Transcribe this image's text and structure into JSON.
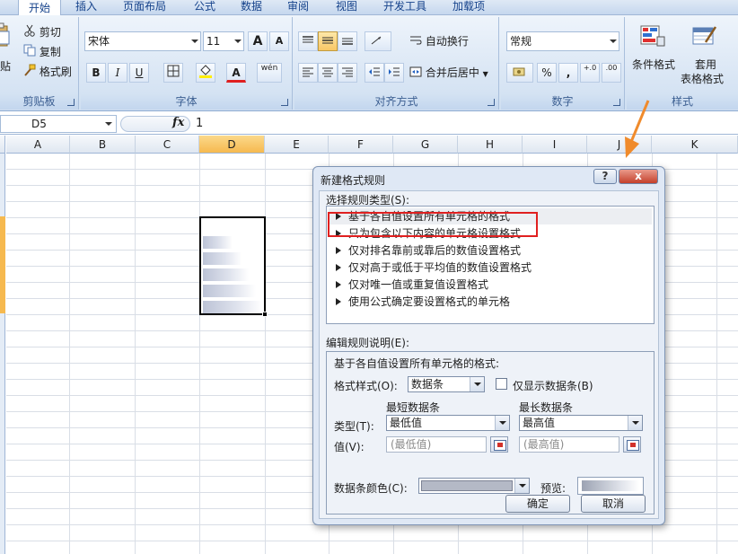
{
  "ribbon": {
    "tabs": [
      "开始",
      "插入",
      "页面布局",
      "公式",
      "数据",
      "审阅",
      "视图",
      "开发工具",
      "加载项"
    ],
    "clipboard": {
      "paste": "贴",
      "cut": "剪切",
      "copy": "复制",
      "format_painter": "格式刷",
      "label": "剪贴板"
    },
    "font": {
      "name": "宋体",
      "size": "11",
      "grow": "A",
      "shrink": "A",
      "bold": "B",
      "italic": "I",
      "underline": "U",
      "color_a": "A",
      "phonetic": "wén",
      "label": "字体"
    },
    "alignment": {
      "wrap": "自动换行",
      "merge": "合并后居中",
      "label": "对齐方式"
    },
    "number": {
      "format": "常规",
      "percent": "%",
      "comma": ",",
      "inc_dec": "+.0",
      "dec_dec": ".00",
      "label": "数字"
    },
    "styles": {
      "conditional_format": "条件格式",
      "table_format_1": "套用",
      "table_format_2": "表格格式",
      "label": "样式"
    }
  },
  "formula_bar": {
    "name_box": "D5",
    "fx": "fx",
    "value": "1"
  },
  "grid": {
    "columns": [
      "A",
      "B",
      "C",
      "D",
      "E",
      "F",
      "G",
      "H",
      "I",
      "J",
      "K"
    ],
    "selected_column": "D",
    "databar_fractions": [
      0.5,
      0.65,
      0.78,
      0.9,
      1.0
    ]
  },
  "dialog": {
    "title": "新建格式规则",
    "help_btn": "?",
    "close_btn": "x",
    "rule_type_label": "选择规则类型(S):",
    "rule_types": [
      "基于各自值设置所有单元格的格式",
      "只为包含以下内容的单元格设置格式",
      "仅对排名靠前或靠后的数值设置格式",
      "仅对高于或低于平均值的数值设置格式",
      "仅对唯一值或重复值设置格式",
      "使用公式确定要设置格式的单元格"
    ],
    "edit_label": "编辑规则说明(E):",
    "edit_heading": "基于各自值设置所有单元格的格式:",
    "format_style_label": "格式样式(O):",
    "format_style_value": "数据条",
    "show_bar_only_label": "仅显示数据条(B)",
    "shortest_bar_label": "最短数据条",
    "longest_bar_label": "最长数据条",
    "type_label": "类型(T):",
    "type_min_value": "最低值",
    "type_max_value": "最高值",
    "value_label": "值(V):",
    "value_min_placeholder": "(最低值)",
    "value_max_placeholder": "(最高值)",
    "bar_color_label": "数据条颜色(C):",
    "preview_label": "预览:",
    "ok_btn": "确定",
    "cancel_btn": "取消"
  },
  "colors": {
    "annotation": "#f08b2c",
    "highlight_box": "#e02020",
    "ribbon_text": "#15428b"
  }
}
